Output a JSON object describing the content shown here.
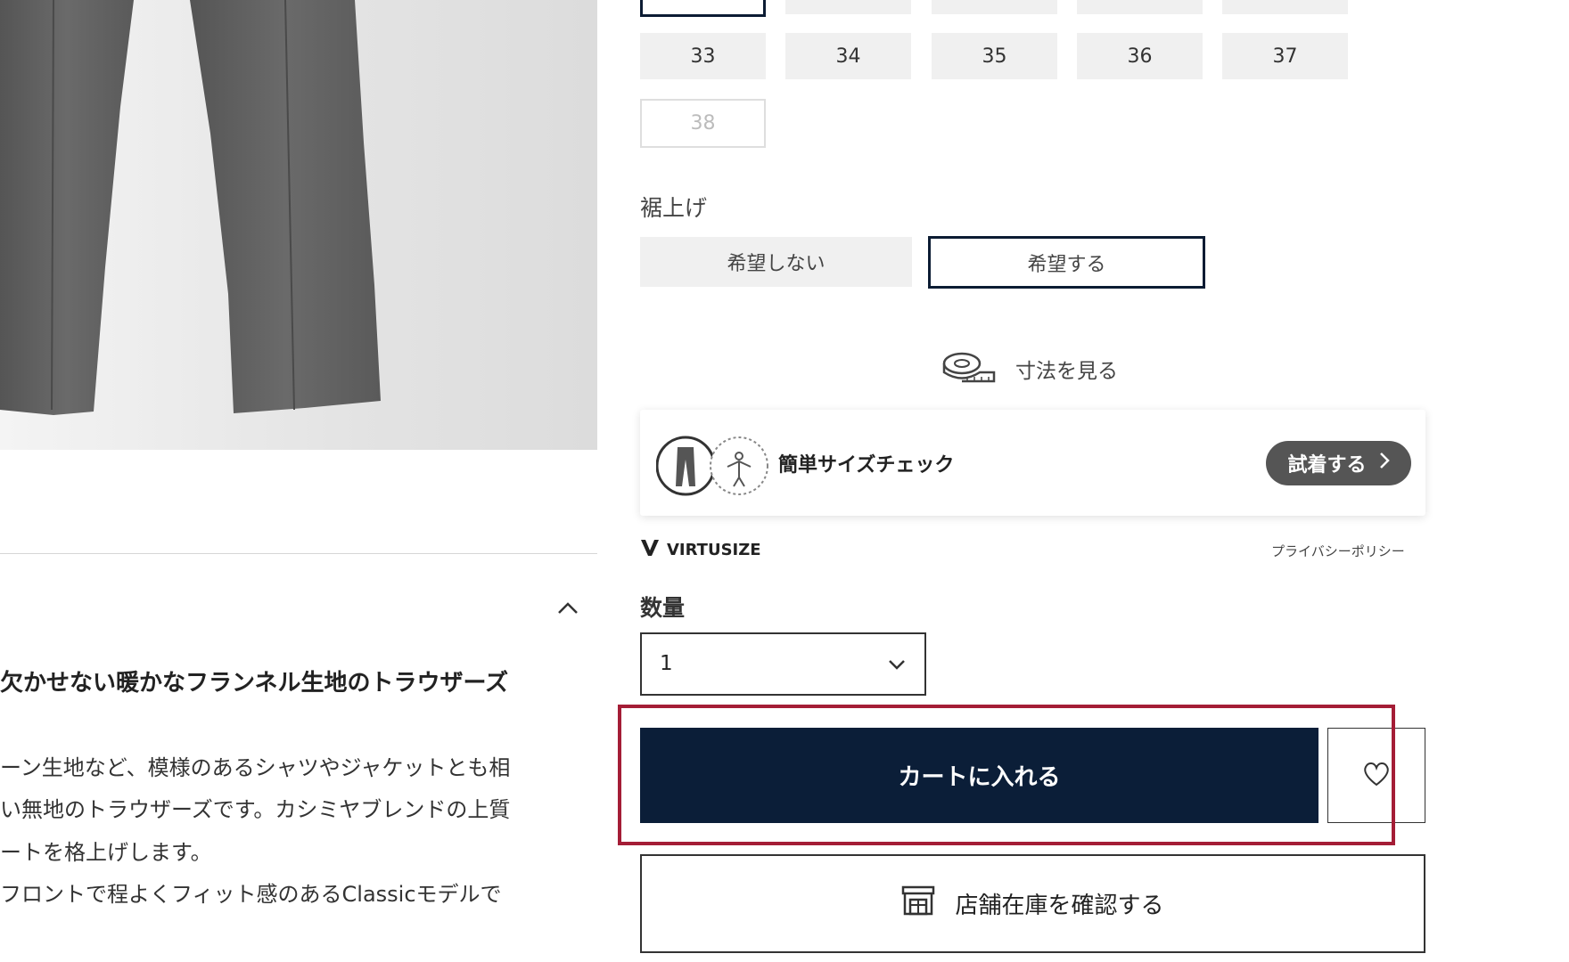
{
  "sizes": {
    "row1": [
      "33",
      "34",
      "35",
      "36",
      "37"
    ],
    "row2": [
      "38"
    ]
  },
  "hem": {
    "label": "裾上げ",
    "options": [
      "希望しない",
      "希望する"
    ],
    "selected": "希望する"
  },
  "measurements_link": {
    "label": "寸法を見る",
    "icon": "tape-measure-icon"
  },
  "size_check": {
    "label": "簡単サイズチェック",
    "try_on_label": "試着する",
    "brand": "VIRTUSIZE",
    "privacy_link": "プライバシーポリシー"
  },
  "quantity": {
    "label": "数量",
    "value": "1"
  },
  "cart": {
    "add_label": "カートに入れる"
  },
  "store_stock": {
    "label": "店舗在庫を確認する"
  },
  "description": {
    "title": "欠かせない暖かなフランネル生地のトラウザーズ",
    "lines": [
      "ーン生地など、模様のあるシャツやジャケットとも相",
      "い無地のトラウザーズです。カシミヤブレンドの上質",
      "ートを格上げします。",
      "フロントで程よくフィット感のあるClassicモデルで"
    ]
  },
  "colors": {
    "navy": "#0b1e38",
    "highlight": "#a41d36",
    "chip_bg": "#f0f0f0"
  }
}
